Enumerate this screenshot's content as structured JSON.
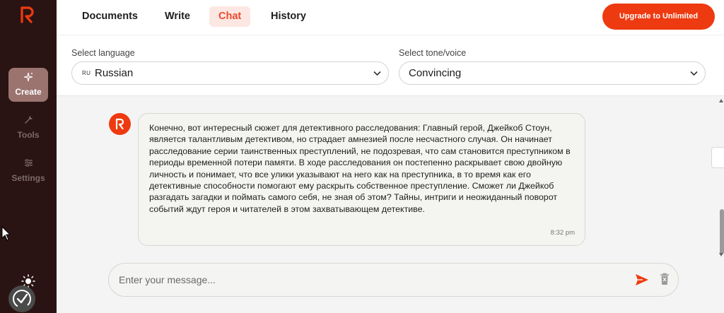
{
  "sidebar": {
    "items": [
      {
        "label": "Create",
        "icon": "sparkle-icon",
        "active": true
      },
      {
        "label": "Tools",
        "icon": "wrench-icon",
        "active": false
      },
      {
        "label": "Settings",
        "icon": "sliders-icon",
        "active": false
      }
    ]
  },
  "nav": {
    "tabs": [
      {
        "label": "Documents"
      },
      {
        "label": "Write"
      },
      {
        "label": "Chat"
      },
      {
        "label": "History"
      }
    ],
    "upgrade_label": "Upgrade to Unlimited"
  },
  "selectors": {
    "language": {
      "label": "Select language",
      "code": "RU",
      "value": "Russian"
    },
    "tone": {
      "label": "Select tone/voice",
      "value": "Convincing"
    }
  },
  "chat": {
    "messages": [
      {
        "text": "Конечно, вот интересный сюжет для детективного расследования: Главный герой, Джейкоб Стоун, является талантливым детективом, но страдает амнезией после несчастного случая. Он начинает расследование серии таинственных преступлений, не подозревая, что сам становится преступником в периоды временной потери памяти. В ходе расследования он постепенно раскрывает свою двойную личность и понимает, что все улики указывают на него как на преступника, в то время как его детективные способности помогают ему раскрыть собственное преступление. Сможет ли Джейкоб разгадать загадки и поймать самого себя, не зная об этом? Тайны, интриги и неожиданный поворот событий ждут героя и читателей в этом захватывающем детективе.",
        "time": "8:32 pm"
      }
    ],
    "input_placeholder": "Enter your message..."
  },
  "colors": {
    "accent": "#ee3a10",
    "sidebar_bg": "#2a1413",
    "active_tab_bg": "#fde7e2",
    "active_tab_text": "#e94b2e"
  }
}
